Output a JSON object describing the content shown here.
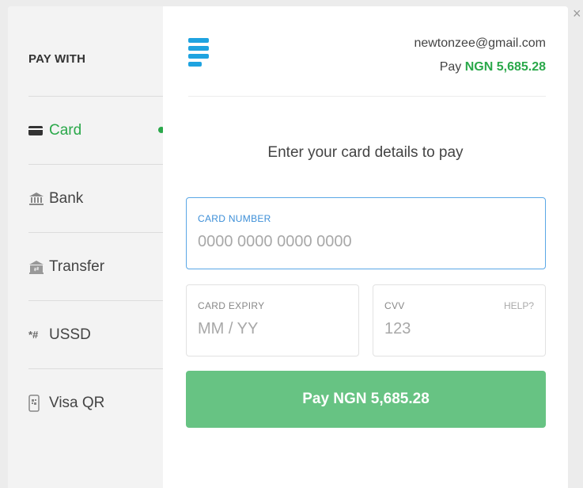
{
  "sidebar": {
    "heading": "PAY WITH",
    "items": [
      {
        "label": "Card",
        "icon": "credit-card-icon",
        "active": true
      },
      {
        "label": "Bank",
        "icon": "bank-icon"
      },
      {
        "label": "Transfer",
        "icon": "transfer-icon"
      },
      {
        "label": "USSD",
        "icon": "ussd-icon",
        "glyph": "*#"
      },
      {
        "label": "Visa QR",
        "icon": "qr-phone-icon"
      }
    ]
  },
  "header": {
    "email": "newtonzee@gmail.com",
    "pay_prefix": "Pay",
    "amount": "NGN 5,685.28"
  },
  "form": {
    "instruction": "Enter your card details to pay",
    "card_number_label": "CARD NUMBER",
    "card_number_placeholder": "0000 0000 0000 0000",
    "expiry_label": "CARD EXPIRY",
    "expiry_placeholder": "MM / YY",
    "cvv_label": "CVV",
    "cvv_placeholder": "123",
    "help_label": "HELP?",
    "pay_button_label": "Pay NGN 5,685.28"
  },
  "colors": {
    "accent_green": "#2aa84a",
    "button_green": "#67c383",
    "focus_blue": "#5aa7e6",
    "logo_blue": "#1fa3e0"
  },
  "close_glyph": "×"
}
